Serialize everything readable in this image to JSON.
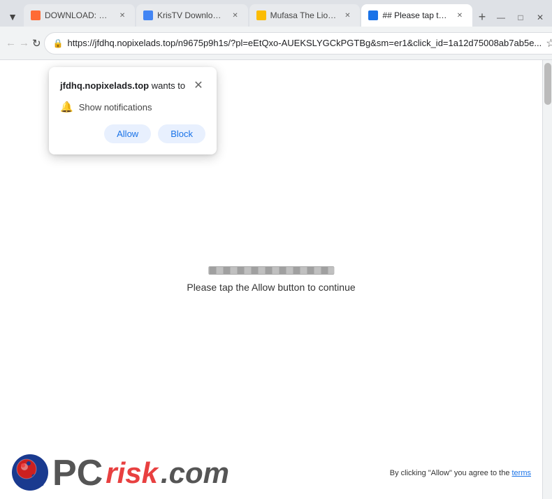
{
  "browser": {
    "tabs": [
      {
        "id": "tab-download",
        "label": "DOWNLOAD: Mufas...",
        "active": false,
        "favicon_color": "#ff6b35"
      },
      {
        "id": "tab-kris",
        "label": "KrisTV Download Pa...",
        "active": false,
        "favicon_color": "#4285f4"
      },
      {
        "id": "tab-mufasa",
        "label": "Mufasa The Lion Kin...",
        "active": false,
        "favicon_color": "#fbbc04"
      },
      {
        "id": "tab-please",
        "label": "## Please tap the All...",
        "active": true,
        "favicon_color": "#1a73e8"
      }
    ],
    "url": "https://jfdhq.nopixelads.top/n9675p9h1s/?pl=eEtQxo-AUEKSLYGCkPGTBg&sm=er1&click_id=1a12d75008ab7ab5e...",
    "window_buttons": [
      "—",
      "□",
      "✕"
    ]
  },
  "popup": {
    "site": "jfdhq.nopixelads.top",
    "wants_to": " wants to",
    "option": "Show notifications",
    "allow_label": "Allow",
    "block_label": "Block"
  },
  "page": {
    "loading_text": "Please tap the Allow button to continue"
  },
  "footer": {
    "logo_pc": "PC",
    "logo_risk": "risk",
    "logo_dotcom": ".com",
    "terms_text": "By clicking \"Allow\" you agree to the ",
    "terms_link": "terms"
  }
}
